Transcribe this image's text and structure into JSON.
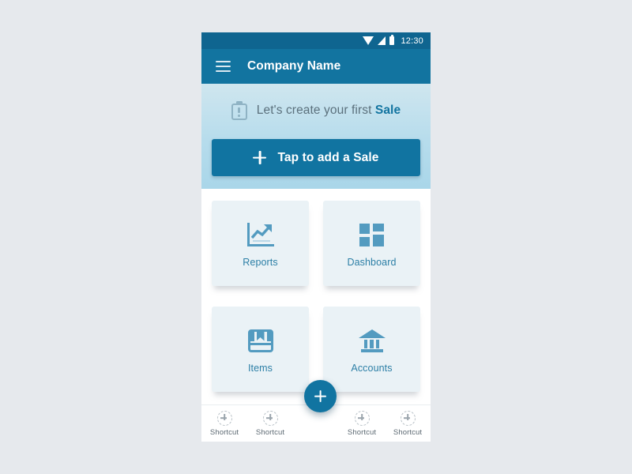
{
  "status_bar": {
    "time": "12:30",
    "icons": [
      "wifi-icon",
      "signal-icon",
      "battery-icon"
    ]
  },
  "app_bar": {
    "menu_icon": "hamburger-menu-icon",
    "title": "Company Name"
  },
  "promo": {
    "icon": "clipboard-alert-icon",
    "text_prefix": "Let's create your first ",
    "text_accent": "Sale",
    "button_label": "Tap to add a Sale",
    "button_icon": "plus-icon",
    "button_color": "#1174a1"
  },
  "cards": [
    {
      "label": "Reports",
      "icon": "chart-trend-up-icon"
    },
    {
      "label": "Dashboard",
      "icon": "grid-tiles-icon"
    },
    {
      "label": "Items",
      "icon": "package-box-icon"
    },
    {
      "label": "Accounts",
      "icon": "bank-building-icon"
    }
  ],
  "fab": {
    "icon": "plus-icon",
    "color": "#1174a1"
  },
  "shortcut_bar": {
    "items": [
      {
        "label": "Shortcut",
        "icon": "add-circle-dashed-icon"
      },
      {
        "label": "Shortcut",
        "icon": "add-circle-dashed-icon"
      },
      {
        "label": "Shortcut",
        "icon": "add-circle-dashed-icon"
      },
      {
        "label": "Shortcut",
        "icon": "add-circle-dashed-icon"
      }
    ]
  },
  "theme": {
    "primary": "#1274a0",
    "status_bar": "#0f6590",
    "card_bg": "#eaf2f6",
    "card_icon": "#539bc0",
    "card_label": "#2c7fa6",
    "page_bg": "#e6e9ed"
  }
}
